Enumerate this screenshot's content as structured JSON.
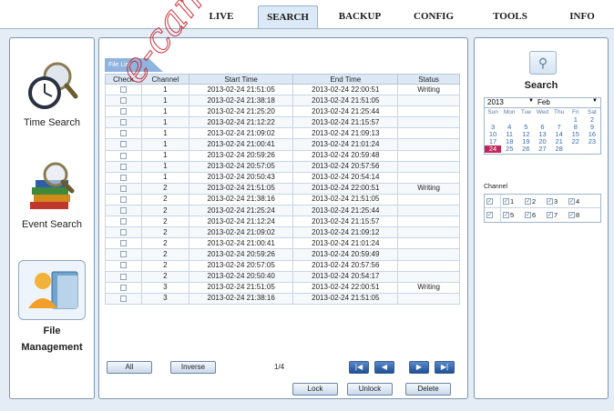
{
  "nav": {
    "tabs": [
      {
        "label": "LIVE"
      },
      {
        "label": "SEARCH",
        "active": true
      },
      {
        "label": "BACKUP"
      },
      {
        "label": "CONFIG"
      },
      {
        "label": "TOOLS"
      },
      {
        "label": "INFO"
      }
    ]
  },
  "sidebar": {
    "time_search": "Time Search",
    "event_search": "Event Search",
    "file_management_line1": "File",
    "file_management_line2": "Management"
  },
  "filelist": {
    "tab_label": "File List",
    "headers": [
      "Check",
      "Channel",
      "Start Time",
      "End Time",
      "Status"
    ],
    "rows": [
      {
        "channel": "1",
        "start": "2013-02-24 21:51:05",
        "end": "2013-02-24 22:00:51",
        "status": "Writing"
      },
      {
        "channel": "1",
        "start": "2013-02-24 21:38:18",
        "end": "2013-02-24 21:51:05",
        "status": ""
      },
      {
        "channel": "1",
        "start": "2013-02-24 21:25:20",
        "end": "2013-02-24 21:25:44",
        "status": ""
      },
      {
        "channel": "1",
        "start": "2013-02-24 21:12:22",
        "end": "2013-02-24 21:15:57",
        "status": ""
      },
      {
        "channel": "1",
        "start": "2013-02-24 21:09:02",
        "end": "2013-02-24 21:09:13",
        "status": ""
      },
      {
        "channel": "1",
        "start": "2013-02-24 21:00:41",
        "end": "2013-02-24 21:01:24",
        "status": ""
      },
      {
        "channel": "1",
        "start": "2013-02-24 20:59:26",
        "end": "2013-02-24 20:59:48",
        "status": ""
      },
      {
        "channel": "1",
        "start": "2013-02-24 20:57:05",
        "end": "2013-02-24 20:57:56",
        "status": ""
      },
      {
        "channel": "1",
        "start": "2013-02-24 20:50:43",
        "end": "2013-02-24 20:54:14",
        "status": ""
      },
      {
        "channel": "2",
        "start": "2013-02-24 21:51:05",
        "end": "2013-02-24 22:00:51",
        "status": "Writing"
      },
      {
        "channel": "2",
        "start": "2013-02-24 21:38:16",
        "end": "2013-02-24 21:51:05",
        "status": ""
      },
      {
        "channel": "2",
        "start": "2013-02-24 21:25:24",
        "end": "2013-02-24 21:25:44",
        "status": ""
      },
      {
        "channel": "2",
        "start": "2013-02-24 21:12:24",
        "end": "2013-02-24 21:15:57",
        "status": ""
      },
      {
        "channel": "2",
        "start": "2013-02-24 21:09:02",
        "end": "2013-02-24 21:09:12",
        "status": ""
      },
      {
        "channel": "2",
        "start": "2013-02-24 21:00:41",
        "end": "2013-02-24 21:01:24",
        "status": ""
      },
      {
        "channel": "2",
        "start": "2013-02-24 20:59:26",
        "end": "2013-02-24 20:59:49",
        "status": ""
      },
      {
        "channel": "2",
        "start": "2013-02-24 20:57:05",
        "end": "2013-02-24 20:57:56",
        "status": ""
      },
      {
        "channel": "2",
        "start": "2013-02-24 20:50:40",
        "end": "2013-02-24 20:54:17",
        "status": ""
      },
      {
        "channel": "3",
        "start": "2013-02-24 21:51:05",
        "end": "2013-02-24 22:00:51",
        "status": "Writing"
      },
      {
        "channel": "3",
        "start": "2013-02-24 21:38:16",
        "end": "2013-02-24 21:51:05",
        "status": ""
      }
    ]
  },
  "controls": {
    "all": "All",
    "inverse": "Inverse",
    "page": "1/4",
    "first": "|◀",
    "prev": "◀",
    "next": "▶",
    "last": "▶|",
    "lock": "Lock",
    "unlock": "Unlock",
    "delete": "Delete"
  },
  "search": {
    "title": "Search",
    "year": "2013",
    "month": "Feb",
    "weekdays": [
      "Sun",
      "Mon",
      "Tue",
      "Wed",
      "Thu",
      "Fri",
      "Sat"
    ],
    "days": [
      "",
      "",
      "",
      "",
      "",
      "1",
      "2",
      "3",
      "4",
      "5",
      "6",
      "7",
      "8",
      "9",
      "10",
      "11",
      "12",
      "13",
      "14",
      "15",
      "16",
      "17",
      "18",
      "19",
      "20",
      "21",
      "22",
      "23",
      "24",
      "25",
      "26",
      "27",
      "28"
    ],
    "selected_day": "24",
    "channel_label": "Channel",
    "channels": [
      "1",
      "2",
      "3",
      "4",
      "5",
      "6",
      "7",
      "8"
    ]
  },
  "watermark": "e-camera-dvr",
  "colors": {
    "accent": "#8fb4de",
    "selected_day": "#c0285a",
    "nav_button": "#1f4f95"
  }
}
